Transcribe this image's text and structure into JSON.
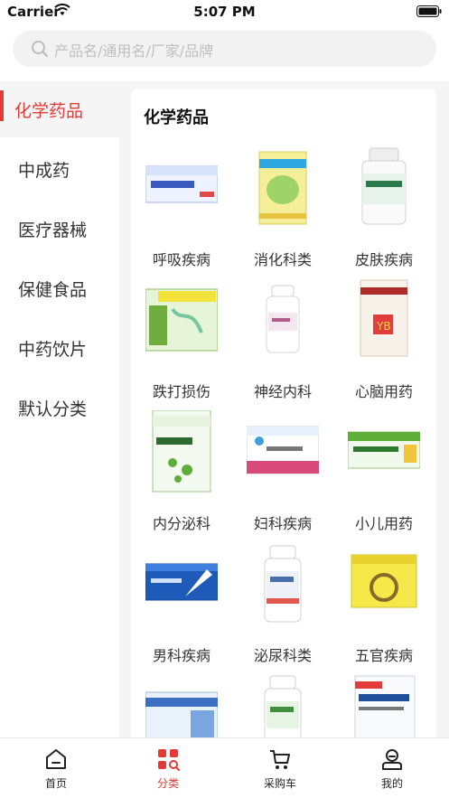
{
  "status_bar": {
    "carrier": "Carrier",
    "time": "5:07 PM"
  },
  "search": {
    "placeholder": "产品名/通用名/厂家/品牌"
  },
  "sidebar": {
    "items": [
      {
        "label": "化学药品",
        "active": true
      },
      {
        "label": "中成药"
      },
      {
        "label": "医疗器械"
      },
      {
        "label": "保健食品"
      },
      {
        "label": "中药饮片"
      },
      {
        "label": "默认分类"
      }
    ]
  },
  "content": {
    "title": "化学药品",
    "categories": [
      {
        "label": "呼吸疾病",
        "icon": "medicine-box-icon"
      },
      {
        "label": "消化科类",
        "icon": "medicine-box-icon"
      },
      {
        "label": "皮肤疾病",
        "icon": "medicine-bottle-icon"
      },
      {
        "label": "跌打损伤",
        "icon": "medicine-box-icon"
      },
      {
        "label": "神经内科",
        "icon": "medicine-bottle-icon"
      },
      {
        "label": "心脑用药",
        "icon": "medicine-box-icon"
      },
      {
        "label": "内分泌科",
        "icon": "medicine-box-icon"
      },
      {
        "label": "妇科疾病",
        "icon": "medicine-box-icon"
      },
      {
        "label": "小儿用药",
        "icon": "medicine-box-icon"
      },
      {
        "label": "男科疾病",
        "icon": "medicine-box-icon"
      },
      {
        "label": "泌尿科类",
        "icon": "medicine-bottle-icon"
      },
      {
        "label": "五官疾病",
        "icon": "medicine-box-icon"
      },
      {
        "label": "",
        "icon": "medicine-box-icon"
      },
      {
        "label": "",
        "icon": "medicine-bottle-icon"
      },
      {
        "label": "",
        "icon": "medicine-box-icon"
      }
    ]
  },
  "tabbar": {
    "items": [
      {
        "label": "首页",
        "icon": "home-icon"
      },
      {
        "label": "分类",
        "icon": "category-icon",
        "active": true
      },
      {
        "label": "采购车",
        "icon": "cart-icon"
      },
      {
        "label": "我的",
        "icon": "user-icon"
      }
    ]
  },
  "colors": {
    "accent": "#e53935",
    "background": "#f5f5f5"
  }
}
